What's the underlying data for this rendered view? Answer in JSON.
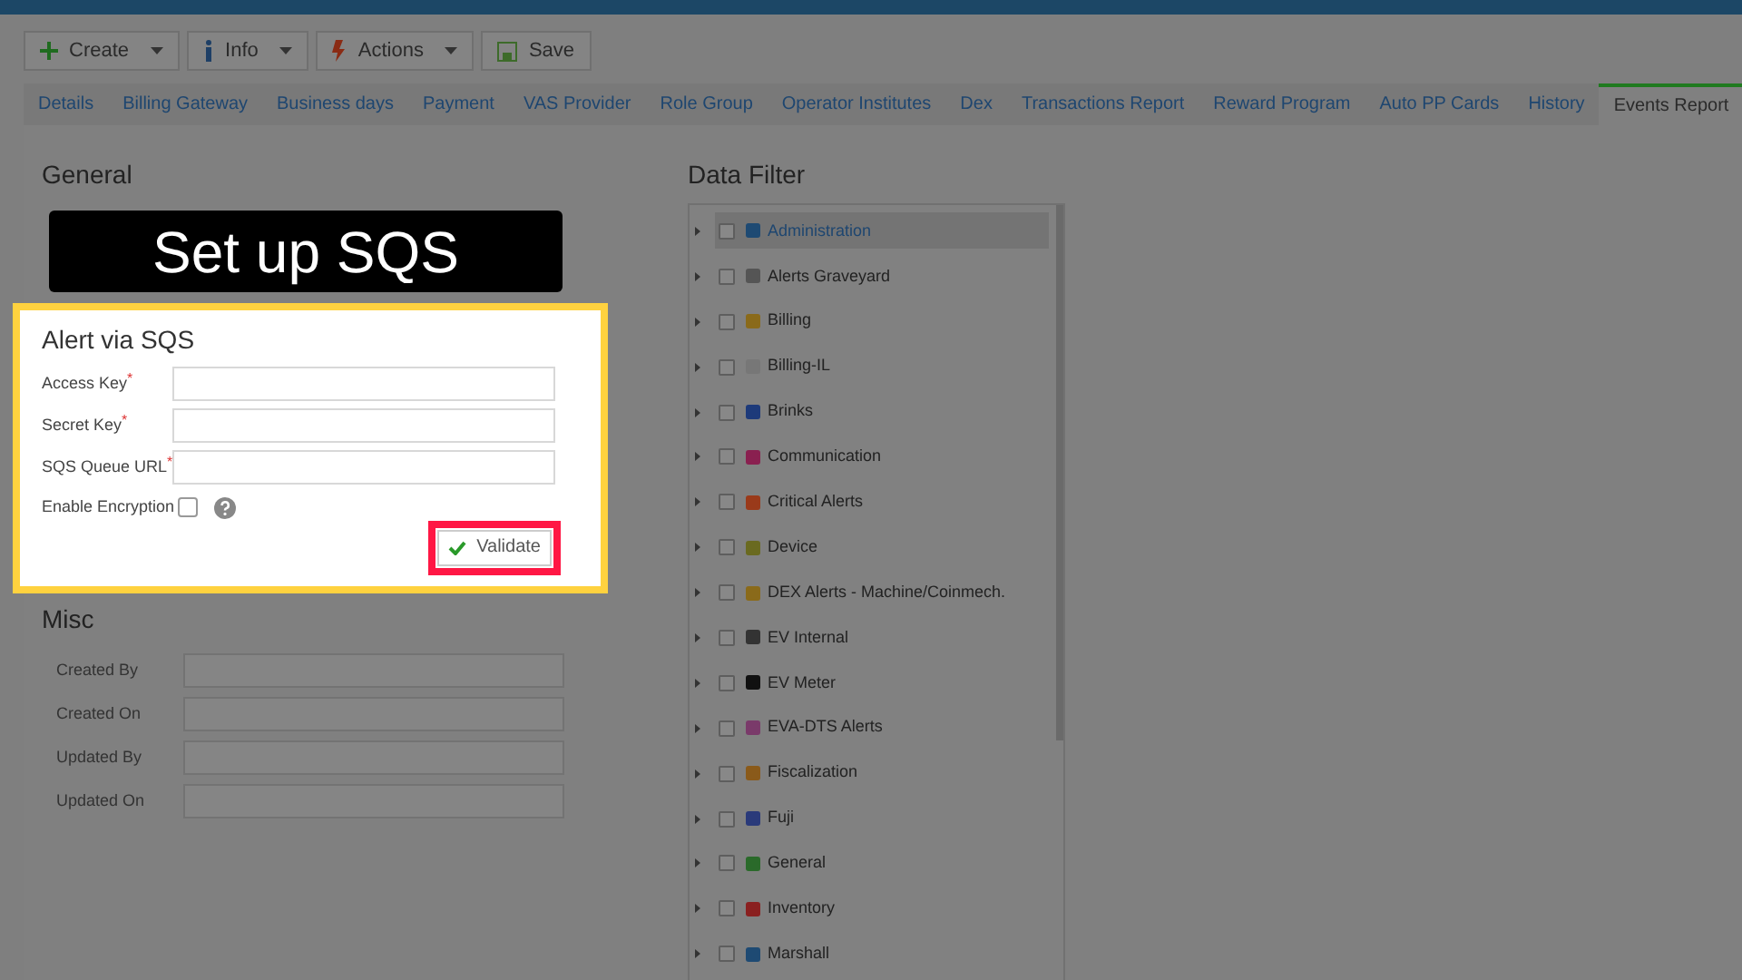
{
  "toolbar": [
    {
      "label": "Create",
      "dropdown": true
    },
    {
      "label": "Info",
      "dropdown": true
    },
    {
      "label": "Actions",
      "dropdown": true
    },
    {
      "label": "Save",
      "dropdown": false
    }
  ],
  "tabs": [
    {
      "label": "Details",
      "selected": false
    },
    {
      "label": "Billing Gateway",
      "selected": false
    },
    {
      "label": "Business days",
      "selected": false
    },
    {
      "label": "Payment",
      "selected": false
    },
    {
      "label": "VAS Provider",
      "selected": false
    },
    {
      "label": "Role Group",
      "selected": false
    },
    {
      "label": "Operator Institutes",
      "selected": false
    },
    {
      "label": "Dex",
      "selected": false
    },
    {
      "label": "Transactions Report",
      "selected": false
    },
    {
      "label": "Reward Program",
      "selected": false
    },
    {
      "label": "Auto PP Cards",
      "selected": false
    },
    {
      "label": "History",
      "selected": false
    },
    {
      "label": "Events Report",
      "selected": true
    }
  ],
  "general": {
    "title": "General",
    "banner": "Set up SQS"
  },
  "alert_card": {
    "title": "Alert via SQS",
    "fields": [
      {
        "label": "Access Key",
        "required_mark": "*"
      },
      {
        "label": "Secret Key",
        "required_mark": "*"
      },
      {
        "label": "SQS Queue URL",
        "required_mark": "*"
      }
    ],
    "encryption": {
      "label": "Enable Encryption",
      "checked": false
    },
    "validate_button": "Validate"
  },
  "misc": {
    "title": "Misc",
    "fields": [
      {
        "label": "Created By"
      },
      {
        "label": "Created On"
      },
      {
        "label": "Updated By"
      },
      {
        "label": "Updated On"
      }
    ]
  },
  "data_filter": {
    "title": "Data Filter",
    "items": [
      {
        "label": "Administration",
        "selected": true,
        "checked": false
      },
      {
        "label": "Alerts Graveyard",
        "selected": false,
        "checked": false
      },
      {
        "label": "Billing",
        "selected": false,
        "checked": false
      },
      {
        "label": "Billing-IL",
        "selected": false,
        "checked": false
      },
      {
        "label": "Brinks",
        "selected": false,
        "checked": false
      },
      {
        "label": "Communication",
        "selected": false,
        "checked": false
      },
      {
        "label": "Critical Alerts",
        "selected": false,
        "checked": false
      },
      {
        "label": "Device",
        "selected": false,
        "checked": false
      },
      {
        "label": "DEX Alerts - Machine/Coinmech.",
        "selected": false,
        "checked": false
      },
      {
        "label": "EV Internal",
        "selected": false,
        "checked": false
      },
      {
        "label": "EV Meter",
        "selected": false,
        "checked": false
      },
      {
        "label": "EVA-DTS Alerts",
        "selected": false,
        "checked": false
      },
      {
        "label": "Fiscalization",
        "selected": false,
        "checked": false
      },
      {
        "label": "Fuji",
        "selected": false,
        "checked": false
      },
      {
        "label": "General",
        "selected": false,
        "checked": false
      },
      {
        "label": "Inventory",
        "selected": false,
        "checked": false
      },
      {
        "label": "Marshall",
        "selected": false,
        "checked": false
      }
    ]
  }
}
